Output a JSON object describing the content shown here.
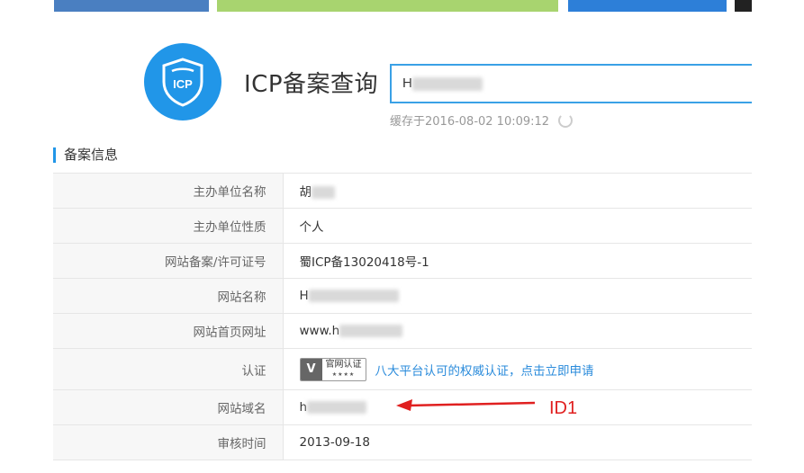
{
  "header": {
    "title": "ICP备案查询",
    "logo_text": "ICP",
    "search_value": "H",
    "cache_text": "缓存于2016-08-02 10:09:12"
  },
  "section": {
    "title": "备案信息"
  },
  "rows": [
    {
      "label": "主办单位名称",
      "value": "胡"
    },
    {
      "label": "主办单位性质",
      "value": "个人"
    },
    {
      "label": "网站备案/许可证号",
      "value": "蜀ICP备13020418号-1"
    },
    {
      "label": "网站名称",
      "value": "H"
    },
    {
      "label": "网站首页网址",
      "value": "www.h"
    },
    {
      "label": "认证",
      "value": ""
    },
    {
      "label": "网站域名",
      "value": "h"
    },
    {
      "label": "审核时间",
      "value": "2013-09-18"
    }
  ],
  "cert": {
    "badge_v": "V",
    "badge_text": "官网认证",
    "badge_stars": "★★★★",
    "link_text": "八大平台认可的权威认证，点击立即申请"
  },
  "annotation": {
    "label": "ID1",
    "color": "#e02020"
  },
  "colors": {
    "accent": "#2196e8",
    "link": "#2a8bdb"
  }
}
